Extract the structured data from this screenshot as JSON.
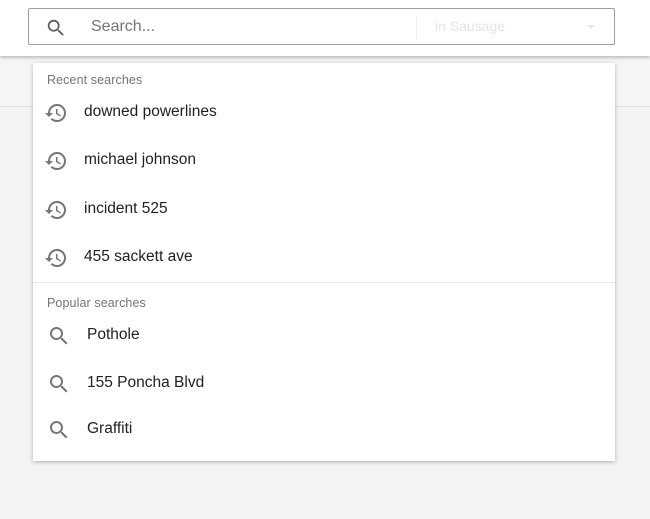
{
  "search": {
    "placeholder": "Search...",
    "scope_label": "in Sausage"
  },
  "recent": {
    "heading": "Recent searches",
    "items": [
      {
        "label": "downed powerlines",
        "icon": "history-icon"
      },
      {
        "label": "michael johnson",
        "icon": "history-icon"
      },
      {
        "label": "incident 525",
        "icon": "history-icon"
      },
      {
        "label": "455 sackett ave",
        "icon": "history-icon"
      }
    ]
  },
  "popular": {
    "heading": "Popular searches",
    "items": [
      {
        "label": "Pothole",
        "icon": "search-icon"
      },
      {
        "label": "155 Poncha Blvd",
        "icon": "search-icon"
      },
      {
        "label": "Graffiti",
        "icon": "search-icon"
      }
    ]
  },
  "colors": {
    "text": "#212121",
    "secondary_text": "#757575",
    "icon": "#757575",
    "background": "#f3f3f3",
    "surface": "#ffffff"
  }
}
